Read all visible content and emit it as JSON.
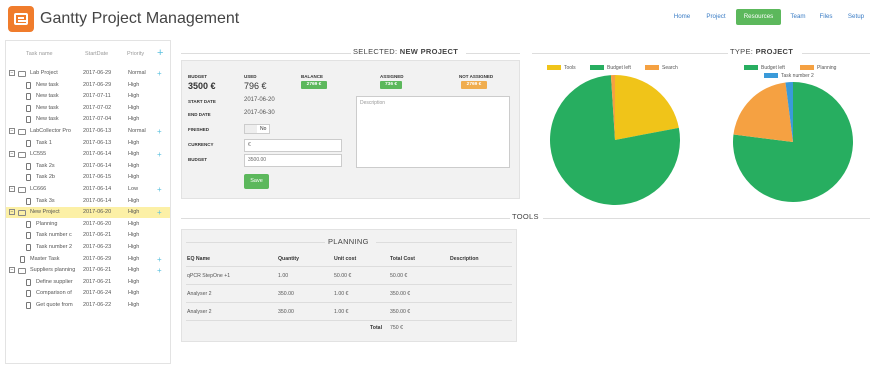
{
  "app": {
    "title": "Gantty Project Management",
    "nav": [
      "Home",
      "Project",
      "Resources",
      "Team",
      "Files",
      "Setup"
    ],
    "active_nav": "Resources",
    "accent": "#5cb85c",
    "logo_color": "#f07c2c"
  },
  "tree": {
    "headers": [
      "Task name",
      "StartDate",
      "Priority"
    ],
    "rows": [
      {
        "name": "Lab Project",
        "date": "2017-06-29",
        "prio": "Normal",
        "level": 0,
        "type": "group",
        "plus": true
      },
      {
        "name": "New task",
        "date": "2017-06-29",
        "prio": "High",
        "level": 1,
        "type": "file"
      },
      {
        "name": "New task",
        "date": "2017-07-11",
        "prio": "High",
        "level": 1,
        "type": "file"
      },
      {
        "name": "New task",
        "date": "2017-07-02",
        "prio": "High",
        "level": 1,
        "type": "file"
      },
      {
        "name": "New task",
        "date": "2017-07-04",
        "prio": "High",
        "level": 1,
        "type": "file"
      },
      {
        "name": "LabCollector Pro",
        "date": "2017-06-13",
        "prio": "Normal",
        "level": 0,
        "type": "folder",
        "plus": true
      },
      {
        "name": "Task 1",
        "date": "2017-06-13",
        "prio": "High",
        "level": 1,
        "type": "file"
      },
      {
        "name": "LC555",
        "date": "2017-06-14",
        "prio": "High",
        "level": 0,
        "type": "group",
        "plus": true
      },
      {
        "name": "Task 2s",
        "date": "2017-06-14",
        "prio": "High",
        "level": 1,
        "type": "file"
      },
      {
        "name": "Task 2b",
        "date": "2017-06-15",
        "prio": "High",
        "level": 1,
        "type": "file"
      },
      {
        "name": "LC666",
        "date": "2017-06-14",
        "prio": "Low",
        "level": 0,
        "type": "group",
        "plus": true
      },
      {
        "name": "Task 3s",
        "date": "2017-06-14",
        "prio": "High",
        "level": 1,
        "type": "file"
      },
      {
        "name": "New Project",
        "date": "2017-06-20",
        "prio": "High",
        "level": 0,
        "type": "folder",
        "plus": true,
        "selected": true
      },
      {
        "name": "Planning",
        "date": "2017-06-20",
        "prio": "High",
        "level": 1,
        "type": "file"
      },
      {
        "name": "Task number c",
        "date": "2017-06-21",
        "prio": "High",
        "level": 1,
        "type": "file"
      },
      {
        "name": "Task number 2",
        "date": "2017-06-23",
        "prio": "High",
        "level": 1,
        "type": "file"
      },
      {
        "name": "Master Task",
        "date": "2017-06-29",
        "prio": "High",
        "level": 0,
        "type": "file",
        "plus": true
      },
      {
        "name": "Suppliers planning",
        "date": "2017-06-21",
        "prio": "High",
        "level": 0,
        "type": "group",
        "plus": true
      },
      {
        "name": "Define supplier",
        "date": "2017-06-21",
        "prio": "High",
        "level": 1,
        "type": "file"
      },
      {
        "name": "Comparison of",
        "date": "2017-06-24",
        "prio": "High",
        "level": 1,
        "type": "file"
      },
      {
        "name": "Get quote from",
        "date": "2017-06-22",
        "prio": "High",
        "level": 1,
        "type": "file"
      }
    ]
  },
  "selected": {
    "heading_prefix": "SELECTED:",
    "heading_name": "NEW PROJECT",
    "budget_label": "BUDGET",
    "budget_value": "3500 €",
    "used_label": "USED",
    "used_value": "796 €",
    "balance_label": "BALANCE",
    "balance_value": "2769 €",
    "assigned_label": "ASSIGNED",
    "assigned_value": "736 €",
    "not_assigned_label": "NOT ASSIGNED",
    "not_assigned_value": "2769 €",
    "start_label": "START DATE",
    "start_value": "2017-06-20",
    "end_label": "END DATE",
    "end_value": "2017-06-30",
    "finished_label": "FINISHED",
    "finished_toggle": "No",
    "currency_label": "CURRENCY",
    "currency_value": "€",
    "budget_input_label": "BUDGET",
    "budget_input_value": "3500.00",
    "description_placeholder": "Description",
    "save_label": "Save",
    "green": "#5cb85c",
    "orange": "#f0ad4e"
  },
  "type": {
    "heading_prefix": "TYPE:",
    "heading_name": "PROJECT"
  },
  "tools": {
    "heading": "TOOLS",
    "planning_title": "PLANNING",
    "columns": [
      "EQ Name",
      "Quantity",
      "Unit cost",
      "Total Cost",
      "Description"
    ],
    "rows": [
      [
        "qPCR StepOne +1",
        "1.00",
        "50.00 €",
        "50.00 €",
        ""
      ],
      [
        "Analyser 2",
        "350.00",
        "1.00 €",
        "350.00 €",
        ""
      ],
      [
        "Analyser 2",
        "350.00",
        "1.00 €",
        "350.00 €",
        ""
      ]
    ],
    "total_label": "Total",
    "total_value": "750 €"
  },
  "pie1": {
    "legend": [
      {
        "name": "Tools",
        "color": "#f0c419"
      },
      {
        "name": "Budget left",
        "color": "#27ae60"
      },
      {
        "name": "Search",
        "color": "#f5a142"
      }
    ]
  },
  "pie2": {
    "legend": [
      {
        "name": "Budget left",
        "color": "#27ae60"
      },
      {
        "name": "Planning",
        "color": "#f5a142"
      },
      {
        "name": "Task number 2",
        "color": "#3a9ad9"
      }
    ]
  },
  "chart_data": [
    {
      "type": "pie",
      "categories": [
        "Tools",
        "Budget left",
        "Search"
      ],
      "values": [
        22,
        77,
        1
      ]
    },
    {
      "type": "pie",
      "categories": [
        "Budget left",
        "Planning",
        "Task number 2"
      ],
      "values": [
        77,
        21,
        2
      ]
    }
  ]
}
